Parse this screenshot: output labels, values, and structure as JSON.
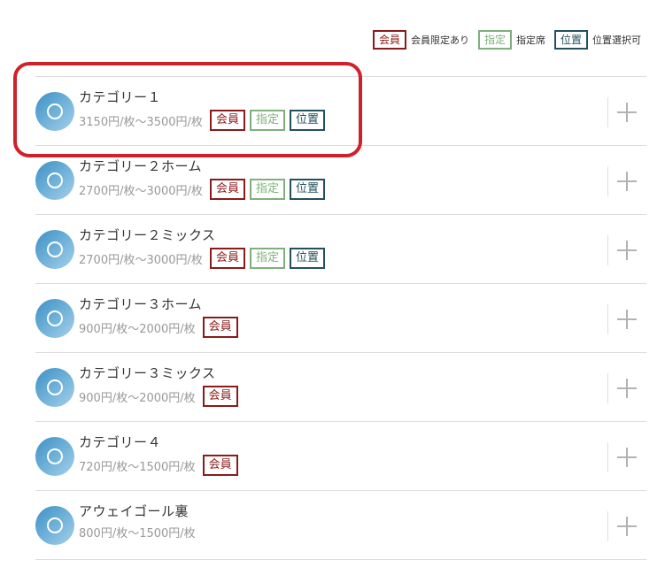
{
  "legend": {
    "items": [
      {
        "tag": "会員",
        "label": "会員限定あり",
        "kind": "member"
      },
      {
        "tag": "指定",
        "label": "指定席",
        "kind": "reserved"
      },
      {
        "tag": "位置",
        "label": "位置選択可",
        "kind": "position"
      }
    ]
  },
  "colors": {
    "member": "#8b1a1a",
    "reserved": "#7fb07a",
    "position": "#24505e",
    "highlight": "#d0202a",
    "circle": "#5aa6d4"
  },
  "tag_labels": {
    "member": "会員",
    "reserved": "指定",
    "position": "位置"
  },
  "categories": [
    {
      "name": "カテゴリー１",
      "price": "3150円/枚～3500円/枚",
      "tags": [
        "member",
        "reserved",
        "position"
      ]
    },
    {
      "name": "カテゴリー２ホーム",
      "price": "2700円/枚～3000円/枚",
      "tags": [
        "member",
        "reserved",
        "position"
      ]
    },
    {
      "name": "カテゴリー２ミックス",
      "price": "2700円/枚～3000円/枚",
      "tags": [
        "member",
        "reserved",
        "position"
      ]
    },
    {
      "name": "カテゴリー３ホーム",
      "price": "900円/枚～2000円/枚",
      "tags": [
        "member"
      ]
    },
    {
      "name": "カテゴリー３ミックス",
      "price": "900円/枚～2000円/枚",
      "tags": [
        "member"
      ]
    },
    {
      "name": "カテゴリー４",
      "price": "720円/枚～1500円/枚",
      "tags": [
        "member"
      ]
    },
    {
      "name": "アウェイゴール裏",
      "price": "800円/枚～1500円/枚",
      "tags": []
    }
  ],
  "icons": {
    "row_icon": "circle-icon",
    "add": "plus-icon"
  }
}
